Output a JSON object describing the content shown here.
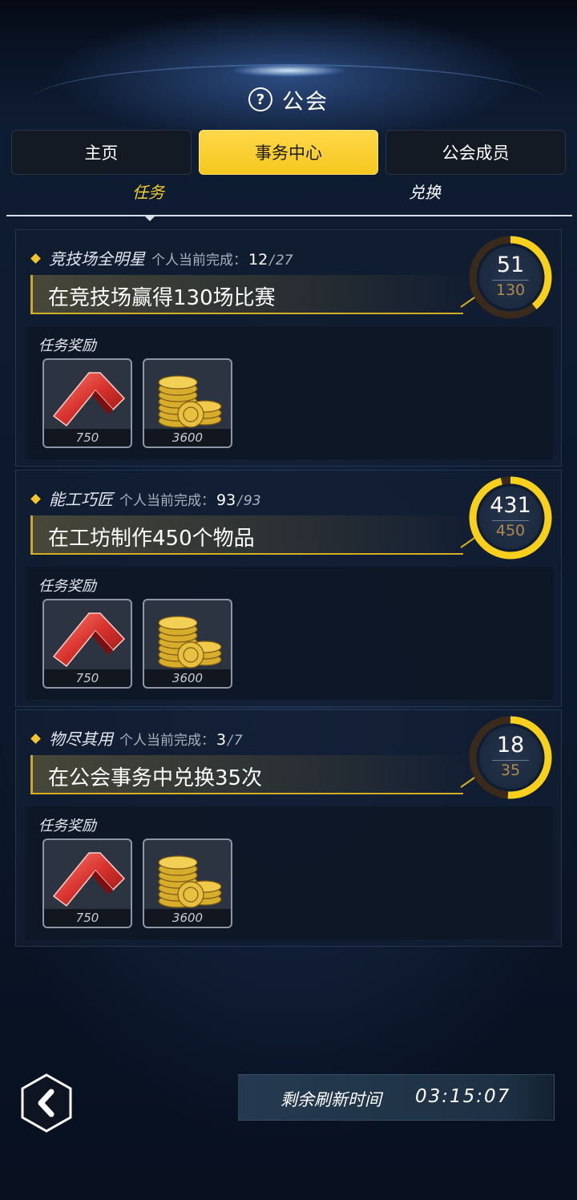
{
  "header": {
    "title": "公会",
    "help_icon": "question-circle-icon"
  },
  "tabs": [
    {
      "label": "主页",
      "active": false
    },
    {
      "label": "事务中心",
      "active": true
    },
    {
      "label": "公会成员",
      "active": false
    }
  ],
  "subtabs": {
    "tasks": "任务",
    "exchange": "兑换",
    "active": "任务"
  },
  "tasks": [
    {
      "name": "竞技场全明星",
      "progress_label": "个人当前完成：",
      "personal_current": "12",
      "personal_total": "27",
      "description": "在竞技场赢得130场比赛",
      "ring_current": "51",
      "ring_total": "130",
      "ring_fraction": 0.39,
      "reward_title": "任务奖励",
      "rewards": [
        {
          "icon": "red-chevron-token-icon",
          "qty": "750"
        },
        {
          "icon": "gold-coins-icon",
          "qty": "3600"
        }
      ]
    },
    {
      "name": "能工巧匠",
      "progress_label": "个人当前完成：",
      "personal_current": "93",
      "personal_total": "93",
      "description": "在工坊制作450个物品",
      "ring_current": "431",
      "ring_total": "450",
      "ring_fraction": 0.96,
      "reward_title": "任务奖励",
      "rewards": [
        {
          "icon": "red-chevron-token-icon",
          "qty": "750"
        },
        {
          "icon": "gold-coins-icon",
          "qty": "3600"
        }
      ]
    },
    {
      "name": "物尽其用",
      "progress_label": "个人当前完成：",
      "personal_current": "3",
      "personal_total": "7",
      "description": "在公会事务中兑换35次",
      "ring_current": "18",
      "ring_total": "35",
      "ring_fraction": 0.51,
      "reward_title": "任务奖励",
      "rewards": [
        {
          "icon": "red-chevron-token-icon",
          "qty": "750"
        },
        {
          "icon": "gold-coins-icon",
          "qty": "3600"
        }
      ]
    }
  ],
  "footer": {
    "back_icon": "chevron-left-icon",
    "refresh_label": "剩余刷新时间",
    "refresh_time": "03:15:07"
  },
  "colors": {
    "accent": "#f5c71e",
    "ring_track": "#3a2a1c",
    "ring_fill": "#f7cf1d"
  }
}
